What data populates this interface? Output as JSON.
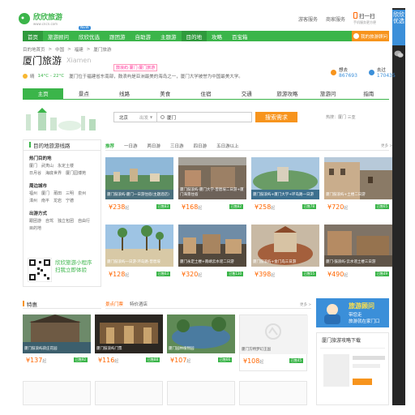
{
  "header": {
    "logo_cn": "欣欣旅游",
    "logo_url": "www.cncn.com",
    "links": [
      "游客服务",
      "商家服务"
    ],
    "app_title": "扫一扫",
    "app_sub": "手机服务更方便"
  },
  "nav": {
    "items": [
      "首页",
      "旅游顾问",
      "欣欣优选",
      "跟团游",
      "自助游",
      "主题游",
      "目的地",
      "攻略",
      "百宝箱"
    ],
    "new_tag": "NEW",
    "advisor": "我的旅游顾问"
  },
  "sidebar": {
    "promo": "欣欣优选",
    "wechat": "wechat-icon"
  },
  "breadcrumb": [
    "目的地首页",
    ">",
    "中国",
    ">",
    "福建",
    ">",
    "厦门旅游"
  ],
  "title": {
    "cn": "厦门旅游",
    "en": "Xiamen",
    "badge": "鼓浪屿·厦门·厦门旅游"
  },
  "weather": {
    "label": "晴",
    "temp": "14°C - 22°C",
    "desc": "厦门位于福建省东南部，鼓浪屿是亚洲最美的海岛之一，厦门大学被誉为中国最美大学。"
  },
  "counts": [
    {
      "label": "想去",
      "value": "867693"
    },
    {
      "label": "去过",
      "value": "170435"
    }
  ],
  "tabs": [
    "主页",
    "景点",
    "线路",
    "美食",
    "住宿",
    "交通",
    "旅游攻略",
    "旅游问",
    "指南"
  ],
  "search": {
    "from": "北京",
    "from_opt": "出发",
    "to": "厦门",
    "button": "搜索需求",
    "hot": "热搜：厦门  三亚"
  },
  "leftpanel": {
    "heading": "目的地旅游线路",
    "sections": [
      {
        "h": "热门目的地",
        "rows": [
          [
            "厦门",
            "武夷山",
            "永定土楼"
          ],
          [
            "日月谷",
            "海底世界",
            "厦门园博苑"
          ]
        ]
      },
      {
        "h": "周边城市",
        "rows": [
          [
            "福州",
            "厦门",
            "莆田",
            "三明",
            "泉州"
          ],
          [
            "漳州",
            "南平",
            "龙岩",
            "宁德"
          ]
        ]
      },
      {
        "h": "出游方式",
        "rows": [
          [
            "跟团游",
            "自驾",
            "独立包团",
            "自由行"
          ],
          [
            "目的地"
          ]
        ]
      }
    ],
    "qr": [
      "欣欣旅游小程序",
      "扫我立即体验"
    ]
  },
  "routes": {
    "tabs": [
      "推荐",
      "一日游",
      "两日游",
      "三日游",
      "四日游",
      "五日游以上"
    ],
    "more": "更多 >",
    "cards": [
      {
        "cap": "厦门鼓浪屿·厦门一日游住宿(主题酒店)",
        "price": "238",
        "unit": "起",
        "tag": "已售83"
      },
      {
        "cap": "厦门鼓浪屿·厦门大学·曾厝垵二日游+厦门海景住宿",
        "price": "168",
        "unit": "起",
        "tag": "已售82"
      },
      {
        "cap": "厦门鼓浪屿+厦门大学+环岛路一日游",
        "price": "258",
        "unit": "起",
        "tag": "已售78"
      },
      {
        "cap": "厦门鼓浪屿+土楼二日游",
        "price": "720",
        "unit": "起",
        "tag": "已售65"
      },
      {
        "cap": "厦门鼓浪屿一日游·环岛路·曾厝垵",
        "price": "128",
        "unit": "起",
        "tag": "已售63"
      },
      {
        "cap": "厦门永定土楼+南靖云水谣二日游",
        "price": "320",
        "unit": "起",
        "tag": "已售130"
      },
      {
        "cap": "厦门鼓浪屿+金门岛三日游",
        "price": "398",
        "unit": "起",
        "tag": "已售55"
      },
      {
        "cap": "厦门·鼓浪屿·云水谣土楼三日游",
        "price": "490",
        "unit": "起",
        "tag": "已售49"
      }
    ]
  },
  "special": {
    "heading": "特惠"
  },
  "deals": {
    "tabs": [
      "景点门票",
      "特价酒店"
    ],
    "more": "更多 >",
    "cards": [
      {
        "cap": "厦门鼓浪屿菽庄花园",
        "price": "137",
        "unit": "起",
        "tag": "已售92"
      },
      {
        "cap": "厦门鼓浪屿门票",
        "price": "116",
        "unit": "起",
        "tag": "已售88"
      },
      {
        "cap": "厦门园林植物园",
        "price": "107",
        "unit": "起",
        "tag": "已售66"
      },
      {
        "cap": "厦门方特梦幻王国",
        "price": "108",
        "unit": "起",
        "tag": "已售45"
      }
    ]
  },
  "promo": {
    "t1": "旅游顾问",
    "t2": "带您走",
    "t3": "旅游就在家门口"
  },
  "guide": {
    "heading": "厦门旅游攻略下载"
  }
}
